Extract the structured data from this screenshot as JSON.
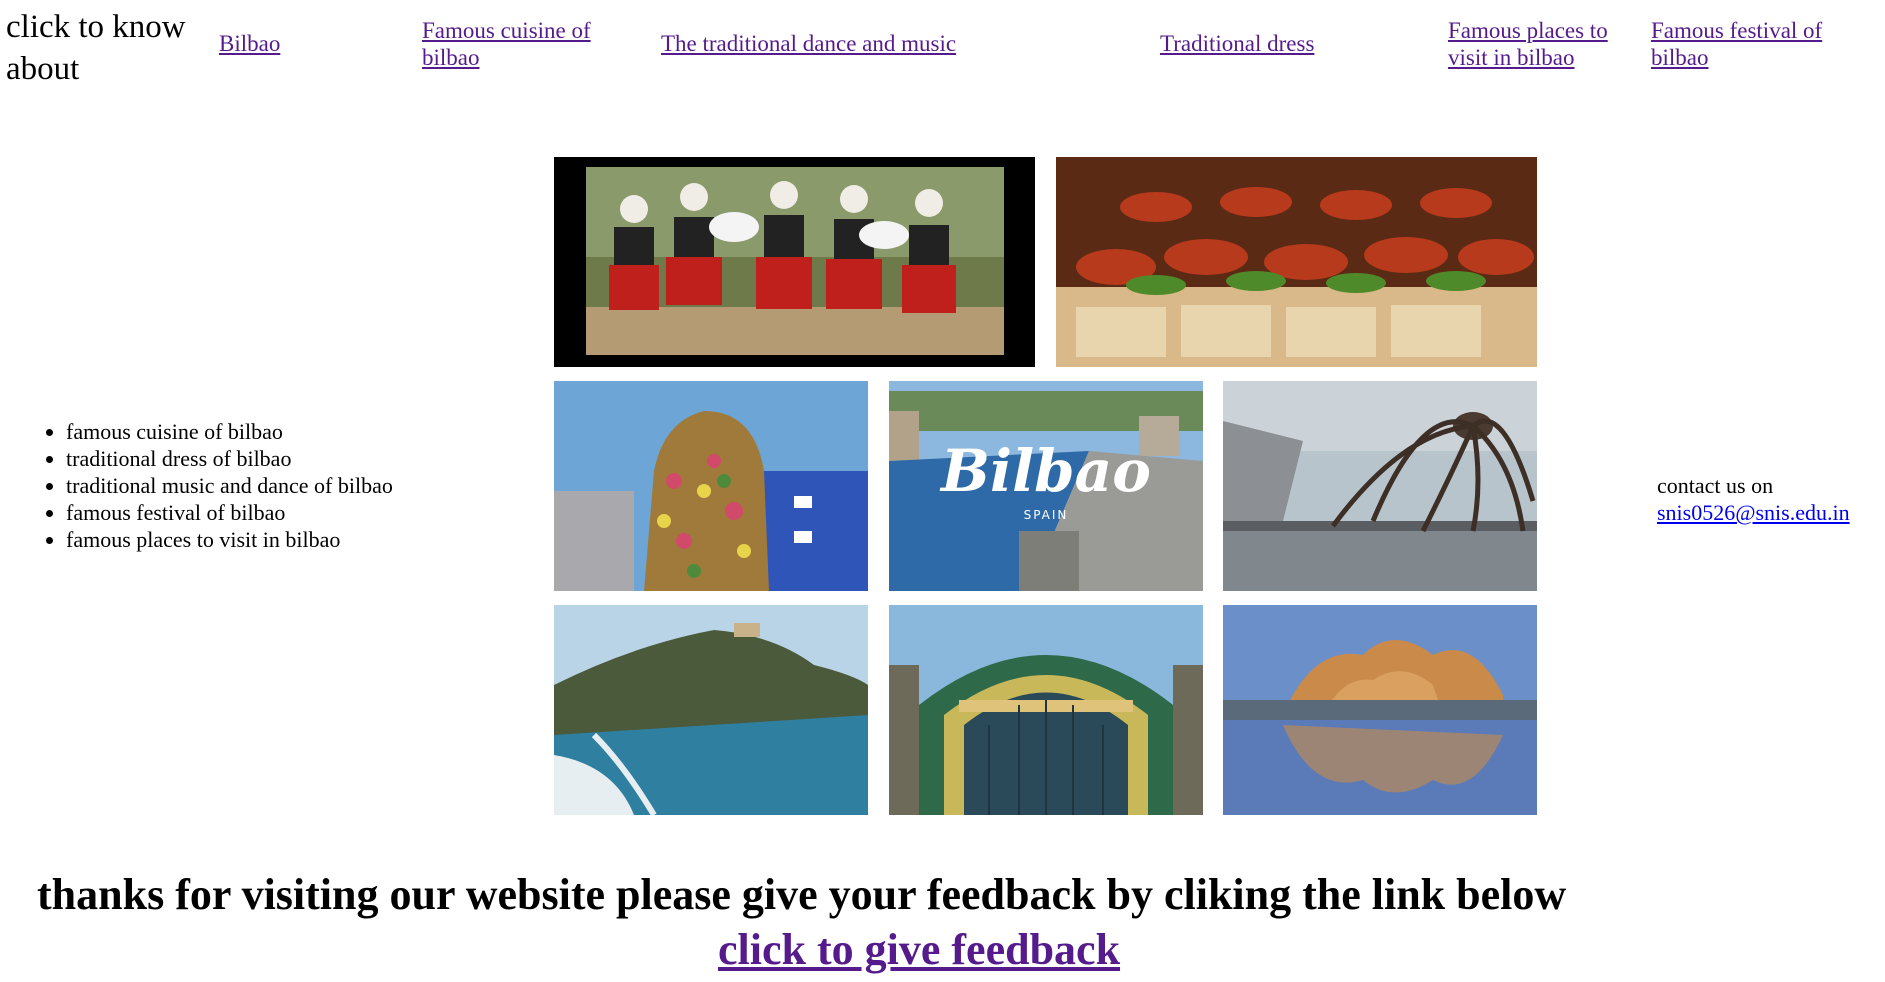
{
  "nav": {
    "title": "click to know about",
    "links": [
      {
        "label": " Bilbao "
      },
      {
        "label": " Famous cuisine of bilbao"
      },
      {
        "label": "The traditional dance and music"
      },
      {
        "label": "Traditional dress"
      },
      {
        "label": "Famous places to visit in bilbao"
      },
      {
        "label": "Famous festival of bilbao"
      }
    ]
  },
  "sidebar": {
    "items": [
      "famous cuisine of bilbao",
      "traditional dress of bilbao",
      "traditional music and dance of bilbao",
      "famous festival of bilbao",
      "famous places to visit in bilbao"
    ]
  },
  "gallery": {
    "bilbao_logo": "Bilbao",
    "bilbao_sub": "SPAIN",
    "images": [
      "dancers-photo",
      "pintxos-photo",
      "puppy-sculpture-photo",
      "bilbao-river-photo",
      "maman-spider-photo",
      "gaztelugatxe-photo",
      "abando-station-photo",
      "guggenheim-photo"
    ]
  },
  "contact": {
    "text": "contact us on",
    "email": "snis0526@snis.edu.in"
  },
  "footer": {
    "thanks": "thanks for visiting our website please give your feedback by cliking the link below",
    "feedback_link": "click to give feedback"
  },
  "colors": {
    "visited_link": "#551a8b",
    "link": "#0000ee",
    "background": "#ffffff"
  }
}
